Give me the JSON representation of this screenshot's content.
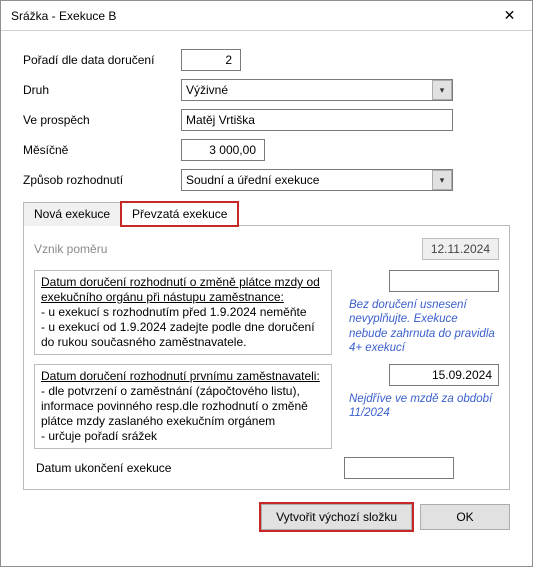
{
  "window": {
    "title": "Srážka - Exekuce B",
    "close_glyph": "✕"
  },
  "form": {
    "poradi_label": "Pořadí dle data doručení",
    "poradi_value": "2",
    "druh_label": "Druh",
    "druh_value": "Výživné",
    "prospech_label": "Ve prospěch",
    "prospech_value": "Matěj Vrtiška",
    "mesicne_label": "Měsíčně",
    "mesicne_value": "3 000,00",
    "zpusob_label": "Způsob rozhodnutí",
    "zpusob_value": "Soudní a úřední exekuce"
  },
  "tabs": {
    "nova": "Nová exekuce",
    "prevzata": "Převzatá exekuce"
  },
  "page": {
    "vznik_label": "Vznik poměru",
    "vznik_date": "12.11.2024",
    "box1_title": "Datum doručení rozhodnutí o změně plátce mzdy od exekučního orgánu při nástupu zaměstnance:",
    "box1_l1": "- u exekucí s rozhodnutím před 1.9.2024 neměňte",
    "box1_l2": "- u exekucí od 1.9.2024 zadejte podle dne doručení do rukou současného zaměstnavatele.",
    "box1_date": "",
    "box1_note": "Bez doručení usnesení nevyplňujte. Exekuce nebude zahrnuta do pravidla 4+ exekucí",
    "box2_title": "Datum doručení rozhodnutí prvnímu zaměstnavateli:",
    "box2_l1": "- dle potvrzení o zaměstnání (zápočtového listu), informace povinného resp.dle rozhodnutí o změně plátce mzdy zaslaného exekučním orgánem",
    "box2_l2": "- určuje pořadí srážek",
    "box2_date": "15.09.2024",
    "box2_note": "Nejdříve ve mzdě za období 11/2024",
    "ukonceni_label": "Datum ukončení exekuce",
    "ukonceni_value": ""
  },
  "footer": {
    "vytvorit": "Vytvořit výchozí složku",
    "ok": "OK"
  }
}
